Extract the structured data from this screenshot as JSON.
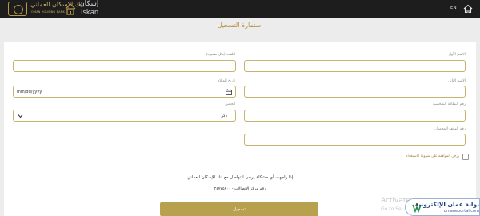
{
  "header": {
    "bank_name_ar": "بنك الإسكان العماني",
    "bank_name_en": "OMAN HOUSING BANK",
    "app_name_ar": "إسكان",
    "app_name_en": "Iskan",
    "language_toggle": "EN",
    "home_icon": "home-icon"
  },
  "page": {
    "title": "استمارة التسجيل"
  },
  "form": {
    "fields": {
      "first_name": {
        "label": "الاسم الأول",
        "value": ""
      },
      "second_name": {
        "label": "الاسم الثاني",
        "value": ""
      },
      "id_number": {
        "label": "رقم البطاقة الشخصية",
        "value": ""
      },
      "phone": {
        "label": "رقم الهاتف المحمول",
        "value": ""
      },
      "last_name": {
        "label": "اللقب (بكل صغيرة)",
        "value": ""
      },
      "dob": {
        "label": "تاريخ الميلاد",
        "value": "mm/dd/yyyy"
      },
      "gender": {
        "label": "الجنس",
        "value": "ذكر"
      }
    },
    "consent_label": "يرجى الموافقة على شروط الاستخدام",
    "notice_text": "إذا واجهت أي مشكلة يرجى التواصل مع بنك الإسكان العماني",
    "call_center_text": "رقم مركز الاتصالات - ٢٤٧٧٥٨٠٠",
    "submit_label": "تسجيل"
  },
  "overlay": {
    "activate_line1": "Activate",
    "activate_line2": "Go to Se",
    "portal_name_ar": "بوابة عمان الإلكترونية",
    "portal_url": "omaneportal.com"
  },
  "colors": {
    "accent_gold": "#b8a14e",
    "title_gold": "#b08e3a",
    "header_bg": "#1d1d1d",
    "page_bg": "#ececec"
  }
}
